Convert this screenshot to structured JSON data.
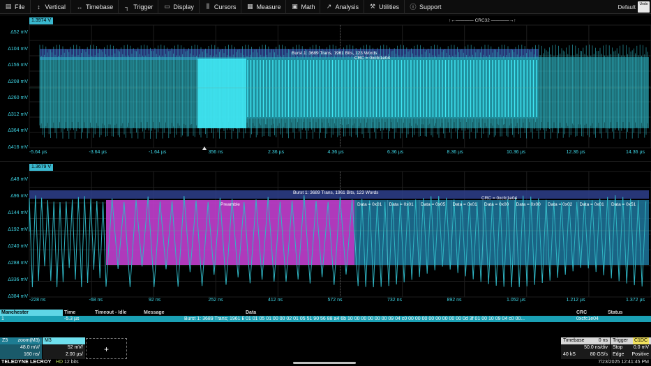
{
  "menu": {
    "items": [
      {
        "icon": "file-icon",
        "glyph": "▤",
        "label": "File"
      },
      {
        "icon": "vertical-icon",
        "glyph": "↕",
        "label": "Vertical"
      },
      {
        "icon": "timebase-icon",
        "glyph": "↔",
        "label": "Timebase"
      },
      {
        "icon": "trigger-icon",
        "glyph": "┐",
        "label": "Trigger"
      },
      {
        "icon": "display-icon",
        "glyph": "▭",
        "label": "Display"
      },
      {
        "icon": "cursors-icon",
        "glyph": "⫼",
        "label": "Cursors"
      },
      {
        "icon": "measure-icon",
        "glyph": "▦",
        "label": "Measure"
      },
      {
        "icon": "math-icon",
        "glyph": "▣",
        "label": "Math"
      },
      {
        "icon": "analysis-icon",
        "glyph": "↗",
        "label": "Analysis"
      },
      {
        "icon": "utilities-icon",
        "glyph": "⚒",
        "label": "Utilities"
      },
      {
        "icon": "support-icon",
        "glyph": "ⓘ",
        "label": "Support"
      }
    ],
    "default_label": "Default",
    "undo_label": "Undo"
  },
  "grid1": {
    "badge": "1.3974 V",
    "vlabels": [
      "Δ52 mV",
      "Δ104 mV",
      "Δ156 mV",
      "Δ208 mV",
      "Δ260 mV",
      "Δ312 mV",
      "Δ364 mV",
      "Δ416 mV"
    ],
    "tlabels": [
      "-5.64 µs",
      "-3.64 µs",
      "-1.64 µs",
      "356 ns",
      "2.36 µs",
      "4.36 µs",
      "6.36 µs",
      "8.36 µs",
      "10.36 µs",
      "12.36 µs",
      "14.36 µs"
    ],
    "burst": "Burst 1: 3689 Trans, 1961 Bits, 123 Words",
    "crc": "CRC = 0xcfc1e04",
    "crc32": "CRC32"
  },
  "grid2": {
    "badge": "1.3679 V",
    "vlabels": [
      "Δ48 mV",
      "Δ96 mV",
      "Δ144 mV",
      "Δ192 mV",
      "Δ240 mV",
      "Δ288 mV",
      "Δ336 mV",
      "Δ384 mV"
    ],
    "tlabels": [
      "-228 ns",
      "-68 ns",
      "92 ns",
      "252 ns",
      "412 ns",
      "572 ns",
      "732 ns",
      "892 ns",
      "1.052 µs",
      "1.212 µs",
      "1.372 µs"
    ],
    "burst": "Burst 1: 3689 Trans, 1961 Bits, 123 Words",
    "crc": "CRC = 0xcfc1e04",
    "preamble": "Preamble",
    "data_labels": [
      "Data = 0x01",
      "Data = 0x01",
      "Data = 0x05",
      "Data = 0x01",
      "Data = 0x00",
      "Data = 0x00",
      "Data = 0x02",
      "Data = 0x01",
      "Data = 0x51"
    ]
  },
  "table": {
    "headers": [
      "Manchester",
      "Time",
      "Timeout - Idle",
      "Message",
      "Data",
      "CRC",
      "Status"
    ],
    "row": {
      "index": "1",
      "time": "-5.3 µs",
      "timeout": "",
      "message": "Burst 1: 3689 Trans; 1961 Bits; 123...",
      "data": "01 01 05 01 00 00 02 01 05 51 90 56 88 a4 6b 10 00 00 00 00 00 09 04 c0 00 00 00 00 00 00 00 00 0d 3f 01 00 10 09 04 c0 00...",
      "crc": "0xcfc1e04",
      "status": ""
    }
  },
  "descriptors": {
    "z3": {
      "name": "Z3",
      "source": "zoom(M3)",
      "vdiv": "48.0 mV/",
      "tdiv": "160 ns/"
    },
    "m3": {
      "name": "M3",
      "vdiv": "52 mV/",
      "tdiv": "2.00 µs/"
    },
    "add": "+",
    "timebase": {
      "title": "Timebase",
      "delay": "0 ns",
      "tdiv": "50.0 ns/div",
      "samples": "40 kS",
      "rate": "80 GS/s"
    },
    "trigger": {
      "title": "Trigger",
      "source": "C1DC",
      "mode": "Stop",
      "level": "0.0 mV",
      "type": "Edge",
      "slope": "Positive"
    }
  },
  "status": {
    "brand": "TELEDYNE LECROY",
    "hd": "HD",
    "bits": "12 bits",
    "datetime": "7/23/2025 12:41:45 PM"
  },
  "colors": {
    "trace": "#2fb6c4",
    "decode_bg": "#2e3f8c",
    "packet": "#40e8f5",
    "preamble": "#c23fcf",
    "label": "#3fd6e6"
  }
}
